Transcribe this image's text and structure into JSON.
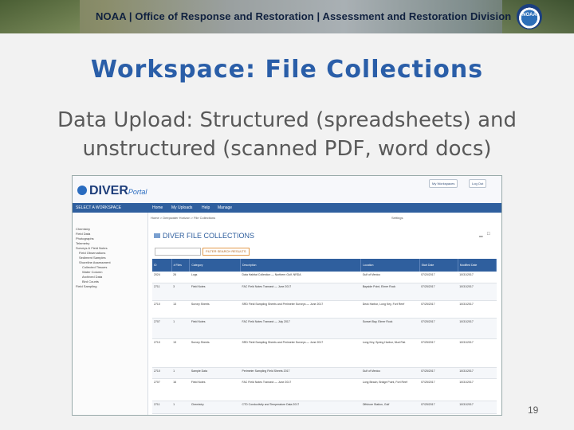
{
  "banner": {
    "text": "NOAA | Office of Response and Restoration | Assessment and Restoration Division",
    "logo_text": "NOAA"
  },
  "slide": {
    "title": "Workspace: File Collections",
    "subtitle": "Data Upload: Structured (spreadsheets) and unstructured (scanned PDF, word docs)",
    "page_number": "19"
  },
  "screenshot": {
    "logo": "DIVER",
    "logo_suffix": "Portal",
    "workspace_label": "SELECT A WORKSPACE",
    "top_buttons": [
      "My Workspaces",
      "Log Out"
    ],
    "nav": [
      "Home",
      "My Uploads",
      "Help",
      "Manage"
    ],
    "breadcrumb": "Home > Deepwater Horizon > File Collections",
    "settings": "Settings",
    "section_title": "DIVER FILE COLLECTIONS",
    "filter_label": "FILTER SEARCH RESULTS",
    "tree": [
      "Chemistry",
      "Field Data",
      "Photographs",
      "Telemetry",
      "Surveys & Field Notes",
      "Field Observations",
      "Sediment Samples",
      "Shoreline Assessment",
      "Collected Tissues",
      "Water Column",
      "Archived Data",
      "Bird Counts",
      "Field Sampling"
    ],
    "table": {
      "headers": [
        "ID",
        "# Files",
        "Category",
        "Description",
        "Location",
        "Start Date",
        "Modified Date"
      ],
      "rows": [
        [
          "2024",
          "26",
          "Logs",
          "Data Habitat Collection — Northern Gulf, NRDA",
          "Gulf of Mexico",
          "07/20/2017",
          "10/31/2017"
        ],
        [
          "2711",
          "3",
          "Field Notes",
          "FAC Field Notes Transect — June 2017",
          "Bayside Point, Elmer Rock",
          "07/25/2017",
          "10/31/2017"
        ],
        [
          "2710",
          "13",
          "Survey Sheets",
          "SRD Field Sampling Sheets and Perimeter Surveys — June 2017",
          "Deck Harbor, Long Key, Fort Reef",
          "07/25/2017",
          "10/31/2017"
        ],
        [
          "2707",
          "1",
          "Field Notes",
          "FAC Field Notes Transect — July 2017",
          "Sunset Bay, Elmer Rock",
          "07/25/2017",
          "10/31/2017"
        ],
        [
          "2710",
          "13",
          "Survey Sheets",
          "SRD Field Sampling Sheets and Perimeter Surveys — June 2017",
          "Long Key, Spring Harbor, Mud Flat",
          "07/25/2017",
          "10/31/2017"
        ],
        [
          "2710",
          "1",
          "Sample Data",
          "Perimeter Sampling Field Sheets 2017",
          "Gulf of Mexico",
          "07/25/2017",
          "10/31/2017"
        ],
        [
          "2707",
          "16",
          "Field Notes",
          "FAC Field Notes Transect — June 2017",
          "Long Beach, Bridge Point, Fort Reef",
          "07/25/2017",
          "10/31/2017"
        ],
        [
          "2711",
          "1",
          "Chemistry",
          "CTD Conductivity and Temperature Data 2017",
          "Offshore Station, Gulf",
          "07/25/2017",
          "10/31/2017"
        ]
      ]
    }
  }
}
